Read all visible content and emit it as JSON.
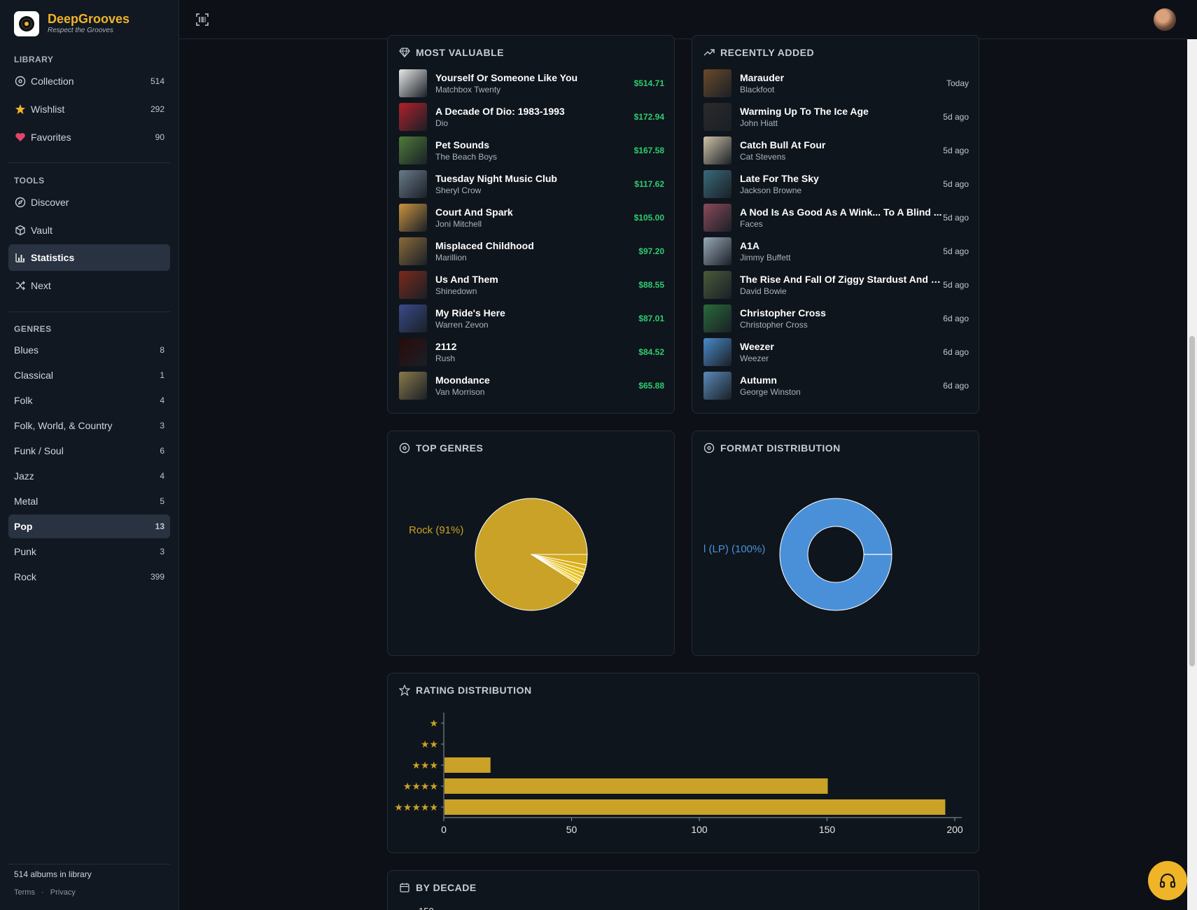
{
  "app": {
    "name": "DeepGrooves",
    "tagline": "Respect the Grooves"
  },
  "sidebar": {
    "library_title": "LIBRARY",
    "library": [
      {
        "label": "Collection",
        "count": "514",
        "icon": "vinyl-icon"
      },
      {
        "label": "Wishlist",
        "count": "292",
        "icon": "star-icon"
      },
      {
        "label": "Favorites",
        "count": "90",
        "icon": "heart-icon"
      }
    ],
    "tools_title": "TOOLS",
    "tools": [
      {
        "label": "Discover",
        "icon": "compass-icon"
      },
      {
        "label": "Vault",
        "icon": "box-icon"
      },
      {
        "label": "Statistics",
        "icon": "bar-chart-icon",
        "active": true
      },
      {
        "label": "Next",
        "icon": "shuffle-icon"
      }
    ],
    "genres_title": "GENRES",
    "genres": [
      {
        "label": "Blues",
        "count": "8"
      },
      {
        "label": "Classical",
        "count": "1"
      },
      {
        "label": "Folk",
        "count": "4"
      },
      {
        "label": "Folk, World, & Country",
        "count": "3"
      },
      {
        "label": "Funk / Soul",
        "count": "6"
      },
      {
        "label": "Jazz",
        "count": "4"
      },
      {
        "label": "Metal",
        "count": "5"
      },
      {
        "label": "Pop",
        "count": "13",
        "active": true
      },
      {
        "label": "Punk",
        "count": "3"
      },
      {
        "label": "Rock",
        "count": "399"
      }
    ],
    "footer": "514 albums in library",
    "terms": "Terms",
    "sep": "·",
    "privacy": "Privacy"
  },
  "most_valuable": {
    "title": "MOST VALUABLE",
    "items": [
      {
        "title": "Yourself Or Someone Like You",
        "artist": "Matchbox Twenty",
        "value": "$514.71",
        "color": "#e8e8e8"
      },
      {
        "title": "A Decade Of Dio: 1983-1993",
        "artist": "Dio",
        "value": "$172.94",
        "color": "#b0202a"
      },
      {
        "title": "Pet Sounds",
        "artist": "The Beach Boys",
        "value": "$167.58",
        "color": "#4f7b3a"
      },
      {
        "title": "Tuesday Night Music Club",
        "artist": "Sheryl Crow",
        "value": "$117.62",
        "color": "#6a7a8a"
      },
      {
        "title": "Court And Spark",
        "artist": "Joni Mitchell",
        "value": "$105.00",
        "color": "#c9933f"
      },
      {
        "title": "Misplaced Childhood",
        "artist": "Marillion",
        "value": "$97.20",
        "color": "#8a6a3a"
      },
      {
        "title": "Us And Them",
        "artist": "Shinedown",
        "value": "$88.55",
        "color": "#7a2a1a"
      },
      {
        "title": "My Ride's Here",
        "artist": "Warren Zevon",
        "value": "$87.01",
        "color": "#3a4a8a"
      },
      {
        "title": "2112",
        "artist": "Rush",
        "value": "$84.52",
        "color": "#2a0a0a"
      },
      {
        "title": "Moondance",
        "artist": "Van Morrison",
        "value": "$65.88",
        "color": "#8a7a4a"
      }
    ]
  },
  "recently_added": {
    "title": "RECENTLY ADDED",
    "items": [
      {
        "title": "Marauder",
        "artist": "Blackfoot",
        "date": "Today",
        "color": "#6a4a2a"
      },
      {
        "title": "Warming Up To The Ice Age",
        "artist": "John Hiatt",
        "date": "5d ago",
        "color": "#2a2a2a"
      },
      {
        "title": "Catch Bull At Four",
        "artist": "Cat Stevens",
        "date": "5d ago",
        "color": "#cfc3a8"
      },
      {
        "title": "Late For The Sky",
        "artist": "Jackson Browne",
        "date": "5d ago",
        "color": "#3a6a7a"
      },
      {
        "title": "A Nod Is As Good As A Wink... To A Blind ...",
        "artist": "Faces",
        "date": "5d ago",
        "color": "#8a4a5a"
      },
      {
        "title": "A1A",
        "artist": "Jimmy Buffett",
        "date": "5d ago",
        "color": "#9aa8b8"
      },
      {
        "title": "The Rise And Fall Of Ziggy Stardust And T...",
        "artist": "David Bowie",
        "date": "5d ago",
        "color": "#4a5a3a"
      },
      {
        "title": "Christopher Cross",
        "artist": "Christopher Cross",
        "date": "6d ago",
        "color": "#2a6a3a"
      },
      {
        "title": "Weezer",
        "artist": "Weezer",
        "date": "6d ago",
        "color": "#4a8ac8"
      },
      {
        "title": "Autumn",
        "artist": "George Winston",
        "date": "6d ago",
        "color": "#5a8ab8"
      }
    ]
  },
  "top_genres": {
    "title": "TOP GENRES",
    "label": "Rock (91%)",
    "label_color": "#c9a227",
    "chart_data": {
      "type": "pie",
      "slices": [
        {
          "label": "Rock",
          "value": 91
        },
        {
          "label": "",
          "value": 3
        },
        {
          "label": "",
          "value": 1.4
        },
        {
          "label": "",
          "value": 1.2
        },
        {
          "label": "",
          "value": 1
        },
        {
          "label": "",
          "value": 1
        },
        {
          "label": "",
          "value": 0.8
        },
        {
          "label": "",
          "value": 0.6
        }
      ],
      "colors": [
        "#c9a227",
        "#d4aa1f",
        "#ddb21a",
        "#e2b818",
        "#e6bd1c",
        "#eac322",
        "#eec92a",
        "#f2cf32"
      ]
    }
  },
  "format_distribution": {
    "title": "FORMAT DISTRIBUTION",
    "label": "l (LP) (100%)",
    "label_color": "#4a90d9",
    "chart_data": {
      "type": "pie",
      "slices": [
        {
          "label": "(LP)",
          "value": 100
        }
      ],
      "colors": [
        "#4a90d9"
      ]
    }
  },
  "rating_distribution": {
    "title": "RATING DISTRIBUTION",
    "chart_data": {
      "type": "bar",
      "orientation": "horizontal",
      "categories": [
        "★",
        "★★",
        "★★★",
        "★★★★",
        "★★★★★"
      ],
      "values": [
        0,
        0,
        18,
        150,
        196
      ],
      "xlim": [
        0,
        200
      ],
      "xticks": [
        "0",
        "50",
        "100",
        "150",
        "200"
      ],
      "color": "#c9a227"
    }
  },
  "by_decade": {
    "title": "BY DECADE",
    "tick": "150"
  }
}
